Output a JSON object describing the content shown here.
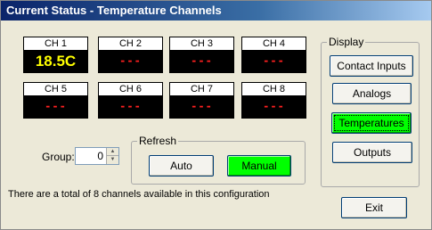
{
  "window": {
    "title": "Current Status - Temperature Channels"
  },
  "channels": [
    {
      "label": "CH 1",
      "value": "18.5C",
      "active": true
    },
    {
      "label": "CH 2",
      "value": "---",
      "active": false
    },
    {
      "label": "CH 3",
      "value": "---",
      "active": false
    },
    {
      "label": "CH 4",
      "value": "---",
      "active": false
    },
    {
      "label": "CH 5",
      "value": "---",
      "active": false
    },
    {
      "label": "CH 6",
      "value": "---",
      "active": false
    },
    {
      "label": "CH 7",
      "value": "---",
      "active": false
    },
    {
      "label": "CH 8",
      "value": "---",
      "active": false
    }
  ],
  "group": {
    "label": "Group:",
    "value": "0"
  },
  "refresh": {
    "legend": "Refresh",
    "auto_label": "Auto",
    "manual_label": "Manual"
  },
  "display": {
    "legend": "Display",
    "contact_inputs_label": "Contact Inputs",
    "analogs_label": "Analogs",
    "temperatures_label": "Temperatures",
    "outputs_label": "Outputs"
  },
  "info_text": "There are a total of 8 channels available in this configuration",
  "exit_label": "Exit",
  "colors": {
    "active_green": "#00ff00",
    "active_value": "#ffff00",
    "inactive_value": "#ff2020",
    "titlebar": "#0a246a"
  }
}
